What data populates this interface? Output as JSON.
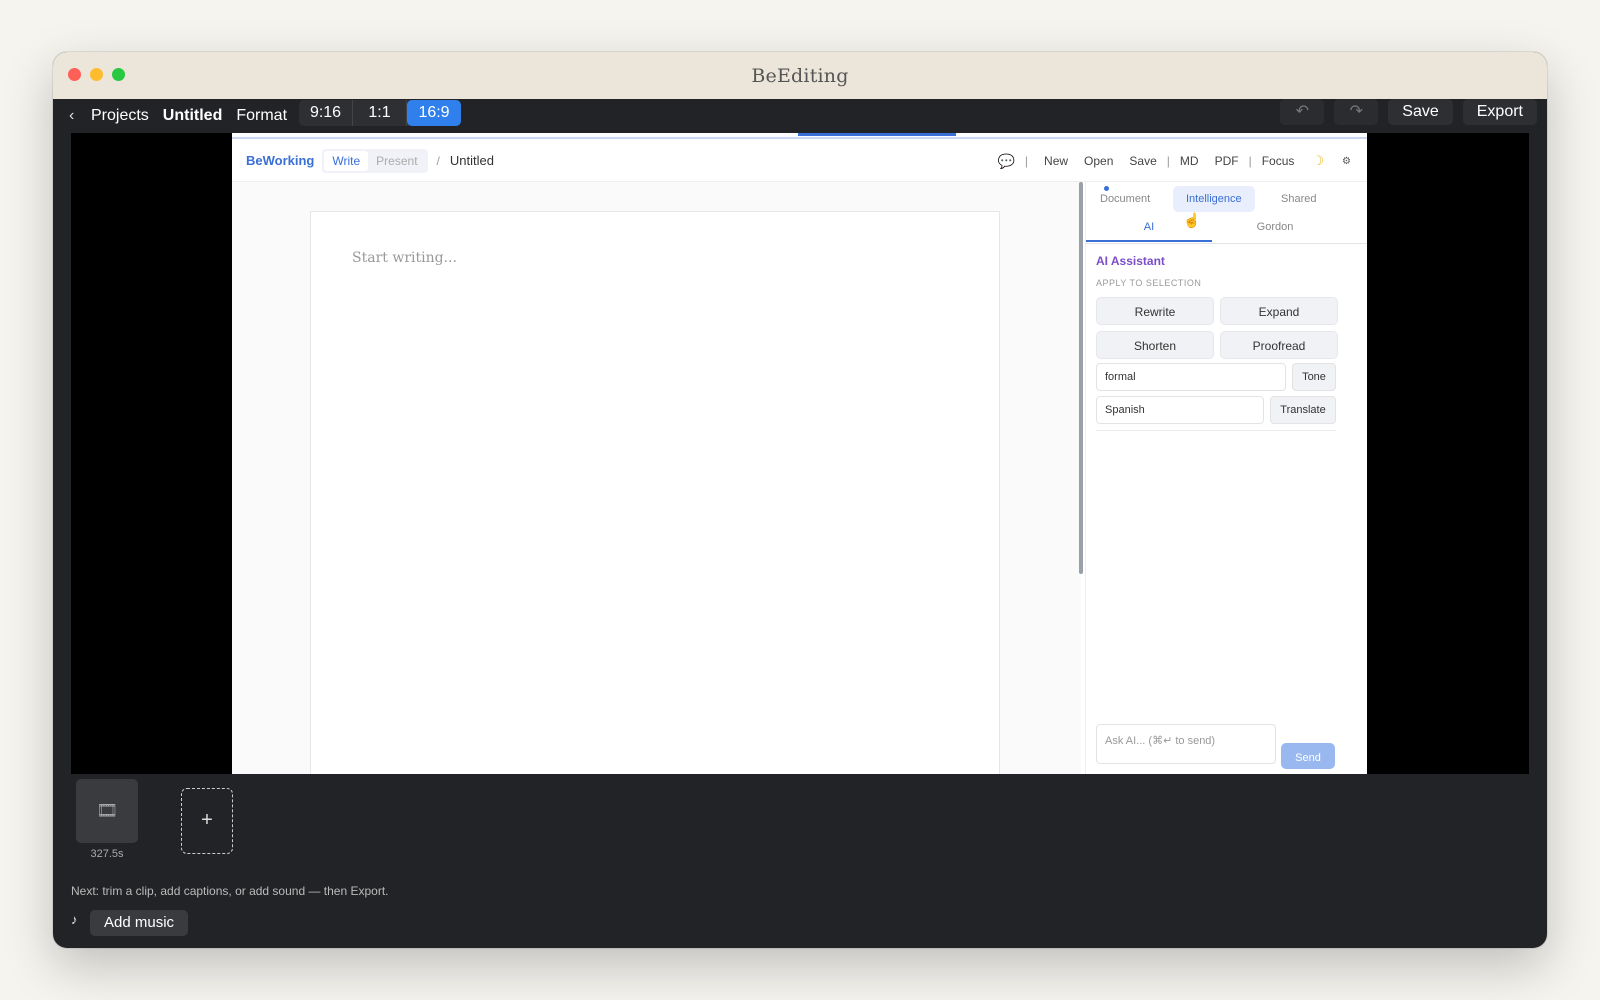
{
  "window": {
    "title": "BeEditing"
  },
  "topbar": {
    "back_label": "‹",
    "projects": "Projects",
    "project_name": "Untitled",
    "format_label": "Format",
    "formats": [
      "9:16",
      "1:1",
      "16:9"
    ],
    "active_format": "16:9",
    "undo_icon": "↶",
    "redo_icon": "↷",
    "save": "Save",
    "export": "Export"
  },
  "app": {
    "brand": "BeWorking",
    "modes": [
      "Write",
      "Present"
    ],
    "active_mode": "Write",
    "crumb_sep": "/",
    "doc_title": "Untitled",
    "menu": {
      "new": "New",
      "open": "Open",
      "save": "Save",
      "md": "MD",
      "pdf": "PDF",
      "focus": "Focus"
    },
    "chat_icon": "💬",
    "moon_icon": "☽",
    "gear_icon": "⚙",
    "placeholder": "Start writing...",
    "sidebar": {
      "tabs": {
        "document": "Document",
        "intelligence": "Intelligence",
        "shared": "Shared"
      },
      "subtabs": {
        "ai": "AI",
        "gordon": "Gordon"
      },
      "ai_title": "AI Assistant",
      "apply_label": "APPLY TO SELECTION",
      "actions": {
        "rewrite": "Rewrite",
        "expand": "Expand",
        "shorten": "Shorten",
        "proofread": "Proofread"
      },
      "tone_value": "formal",
      "tone_button": "Tone",
      "language_value": "Spanish",
      "translate_button": "Translate",
      "ask_placeholder": "Ask AI... (⌘↵ to send)",
      "send": "Send"
    }
  },
  "timeline": {
    "clip_icon": "🎞",
    "clip_duration": "327.5s",
    "add_icon": "+",
    "hint": "Next: trim a clip, add captions, or add sound — then Export.",
    "music_icon": "♪",
    "add_music": "Add music"
  },
  "colors": {
    "accent": "#2f80ed",
    "brand": "#3a6fd8",
    "ai_purple": "#7a4ec9",
    "window_bg": "#222326"
  }
}
